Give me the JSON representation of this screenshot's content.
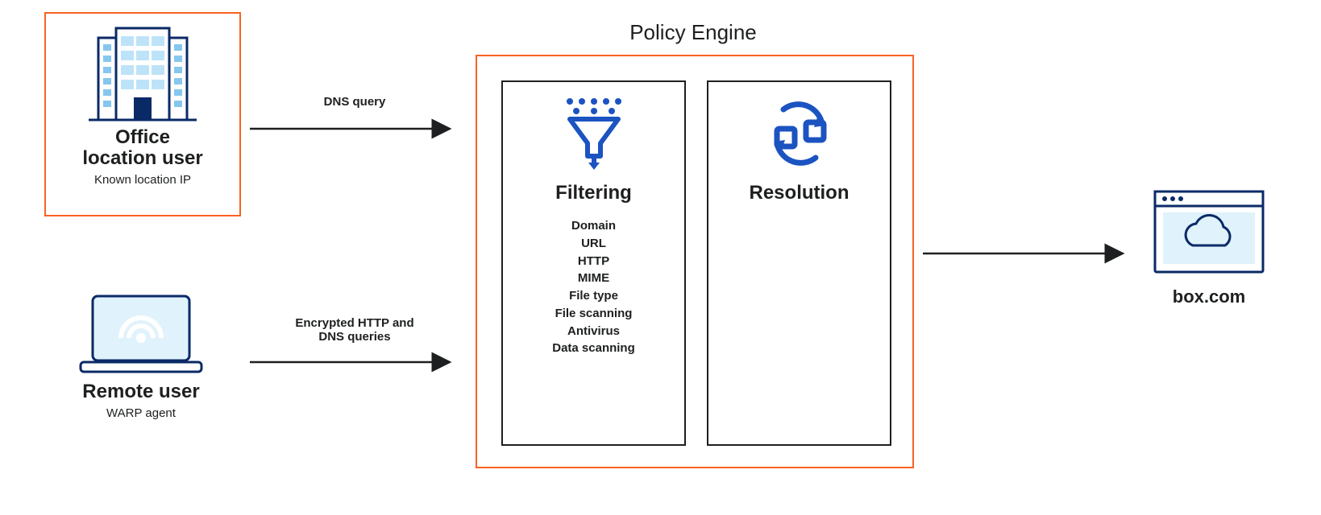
{
  "office": {
    "title_line1": "Office",
    "title_line2": "location user",
    "subtitle": "Known location IP"
  },
  "remote": {
    "title": "Remote user",
    "subtitle": "WARP agent"
  },
  "edges": {
    "dns": "DNS query",
    "https_line1": "Encrypted HTTP and",
    "https_line2": "DNS queries"
  },
  "policy": {
    "title": "Policy Engine",
    "filtering": {
      "title": "Filtering",
      "items": [
        "Domain",
        "URL",
        "HTTP",
        "MIME",
        "File type",
        "File scanning",
        "Antivirus",
        "Data scanning"
      ]
    },
    "resolution": {
      "title": "Resolution"
    }
  },
  "destination": {
    "label": "box.com"
  }
}
